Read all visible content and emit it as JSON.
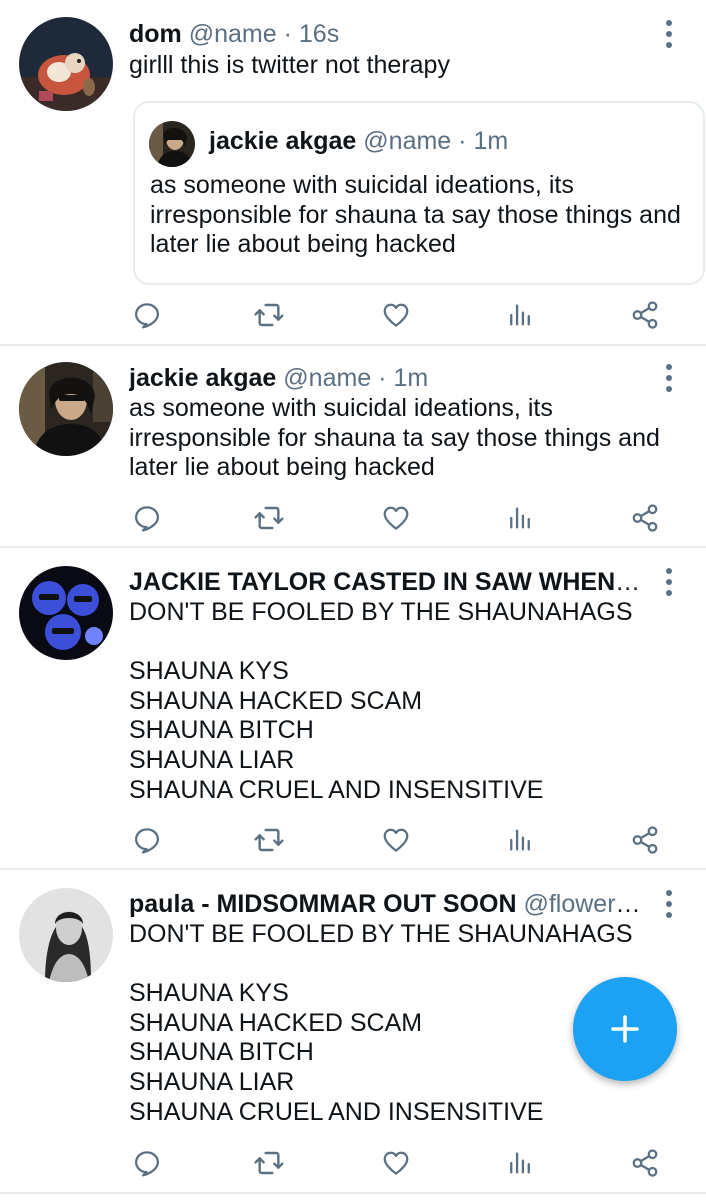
{
  "tweets": [
    {
      "name": "dom",
      "handle": "@name",
      "time": "16s",
      "text": "girlll this is twitter not therapy",
      "quoted": {
        "name": "jackie akgae",
        "handle": "@name",
        "time": "1m",
        "text": "as someone with suicidal ideations, its irresponsible for shauna ta say those things and later lie about being hacked"
      }
    },
    {
      "name": "jackie akgae",
      "handle": "@name",
      "time": "1m",
      "text": "as someone with suicidal ideations, its irresponsible for shauna ta say those things and later lie about being hacked"
    },
    {
      "name": "JACKIE TAYLOR CASTED IN SAW WHEN",
      "handle": "@...",
      "time": "",
      "text": "DON'T BE FOOLED BY THE SHAUNAHAGS\n\nSHAUNA KYS\nSHAUNA HACKED SCAM\nSHAUNA BITCH\nSHAUNA LIAR\nSHAUNA CRUEL AND INSENSITIVE"
    },
    {
      "name": "paula - MIDSOMMAR OUT SOON",
      "handle": "@flowerpi...",
      "time": "",
      "text": "DON'T BE FOOLED BY THE SHAUNAHAGS\n\nSHAUNA KYS\nSHAUNA HACKED SCAM\nSHAUNA BITCH\nSHAUNA LIAR\nSHAUNA CRUEL AND INSENSITIVE"
    }
  ],
  "dot": "·",
  "icons": {
    "reply": "reply-icon",
    "retweet": "retweet-icon",
    "like": "heart-icon",
    "analytics": "analytics-icon",
    "share": "share-icon",
    "more": "more-vertical-icon",
    "compose": "plus-icon"
  },
  "colors": {
    "accent": "#1da1f2",
    "icon": "#5b7083",
    "divider": "#e6ecf0",
    "text": "#0f1419"
  }
}
